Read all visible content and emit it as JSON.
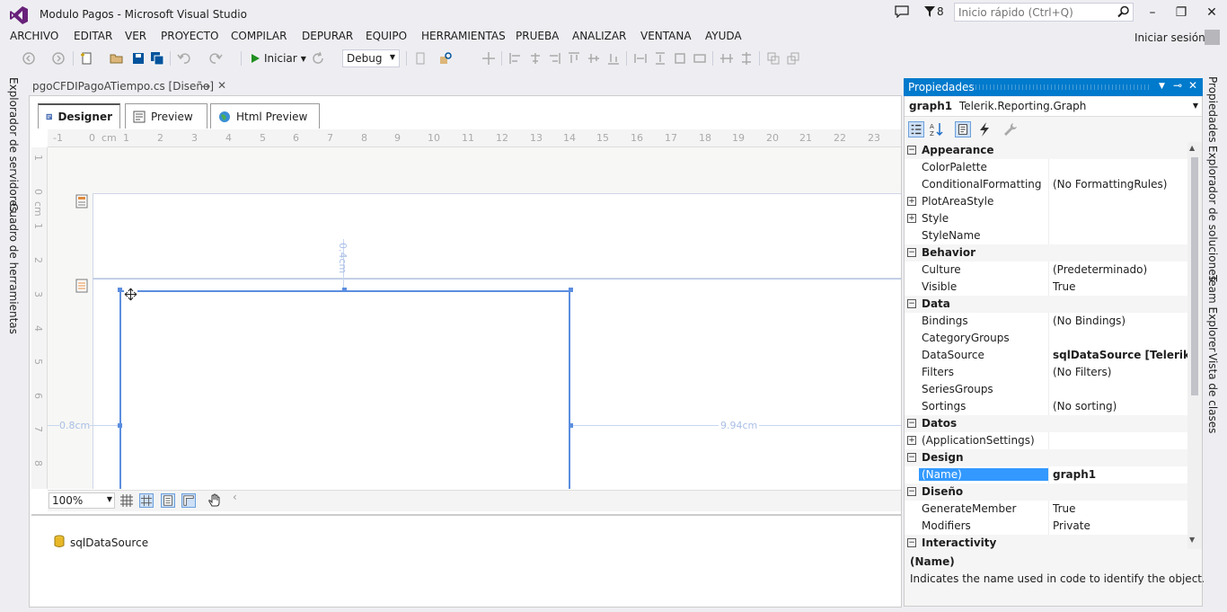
{
  "window": {
    "title": "Modulo Pagos - Microsoft Visual Studio",
    "notification_count": "8",
    "quick_launch_placeholder": "Inicio rápido (Ctrl+Q)",
    "signin": "Iniciar sesión"
  },
  "menu": [
    "ARCHIVO",
    "EDITAR",
    "VER",
    "PROYECTO",
    "COMPILAR",
    "DEPURAR",
    "EQUIPO",
    "HERRAMIENTAS",
    "PRUEBA",
    "ANALIZAR",
    "VENTANA",
    "AYUDA"
  ],
  "toolbar": {
    "run_label": "Iniciar",
    "config": "Debug"
  },
  "left_tabs": [
    "Explorador de servidores",
    "Cuadro de herramientas"
  ],
  "document": {
    "tab_title": "pgoCFDIPagoATiempo.cs [Diseño]",
    "designer_tabs": [
      "Designer",
      "Preview",
      "Html Preview"
    ],
    "ruler_top": [
      "-1",
      "0",
      "cm",
      "1",
      "2",
      "3",
      "4",
      "5",
      "6",
      "7",
      "8",
      "9",
      "10",
      "11",
      "12",
      "13",
      "14",
      "15",
      "16",
      "17",
      "18",
      "19",
      "20",
      "21",
      "22",
      "23"
    ],
    "ruler_left": [
      "1",
      "0",
      "cm",
      "1",
      "2",
      "3",
      "4",
      "5",
      "6",
      "7",
      "8"
    ],
    "dim_top": "0.4cm",
    "dim_left": "0.8cm",
    "dim_right": "9.94cm",
    "zoom": "100%",
    "datasource": "sqlDataSource"
  },
  "properties": {
    "title": "Propiedades",
    "object_name": "graph1",
    "object_type": "Telerik.Reporting.Graph",
    "rows": [
      {
        "type": "cat",
        "name": "Appearance",
        "exp": "⊟"
      },
      {
        "type": "prop",
        "name": "ColorPalette",
        "value": ""
      },
      {
        "type": "prop",
        "name": "ConditionalFormatting",
        "value": "(No FormattingRules)"
      },
      {
        "type": "prop",
        "name": "PlotAreaStyle",
        "value": "",
        "exp": "⊞"
      },
      {
        "type": "prop",
        "name": "Style",
        "value": "",
        "exp": "⊞"
      },
      {
        "type": "prop",
        "name": "StyleName",
        "value": ""
      },
      {
        "type": "cat",
        "name": "Behavior",
        "exp": "⊟"
      },
      {
        "type": "prop",
        "name": "Culture",
        "value": "(Predeterminado)"
      },
      {
        "type": "prop",
        "name": "Visible",
        "value": "True"
      },
      {
        "type": "cat",
        "name": "Data",
        "exp": "⊟"
      },
      {
        "type": "prop",
        "name": "Bindings",
        "value": "(No Bindings)"
      },
      {
        "type": "prop",
        "name": "CategoryGroups",
        "value": ""
      },
      {
        "type": "prop",
        "name": "DataSource",
        "value": "sqlDataSource [Telerik.Rep",
        "bold": true
      },
      {
        "type": "prop",
        "name": "Filters",
        "value": "(No Filters)"
      },
      {
        "type": "prop",
        "name": "SeriesGroups",
        "value": ""
      },
      {
        "type": "prop",
        "name": "Sortings",
        "value": "(No sorting)"
      },
      {
        "type": "cat",
        "name": "Datos",
        "exp": "⊟"
      },
      {
        "type": "prop",
        "name": "(ApplicationSettings)",
        "value": "",
        "exp": "⊞"
      },
      {
        "type": "cat",
        "name": "Design",
        "exp": "⊟"
      },
      {
        "type": "prop",
        "name": "(Name)",
        "value": "graph1",
        "selected": true
      },
      {
        "type": "cat",
        "name": "Diseño",
        "exp": "⊟"
      },
      {
        "type": "prop",
        "name": "GenerateMember",
        "value": "True"
      },
      {
        "type": "prop",
        "name": "Modifiers",
        "value": "Private"
      },
      {
        "type": "cat",
        "name": "Interactivity",
        "exp": "⊟"
      }
    ],
    "desc_title": "(Name)",
    "desc_text": "Indicates the name used in code to identify the object."
  },
  "right_tabs": [
    "Propiedades",
    "Explorador de soluciones",
    "Team Explorer",
    "Vista de clases"
  ]
}
